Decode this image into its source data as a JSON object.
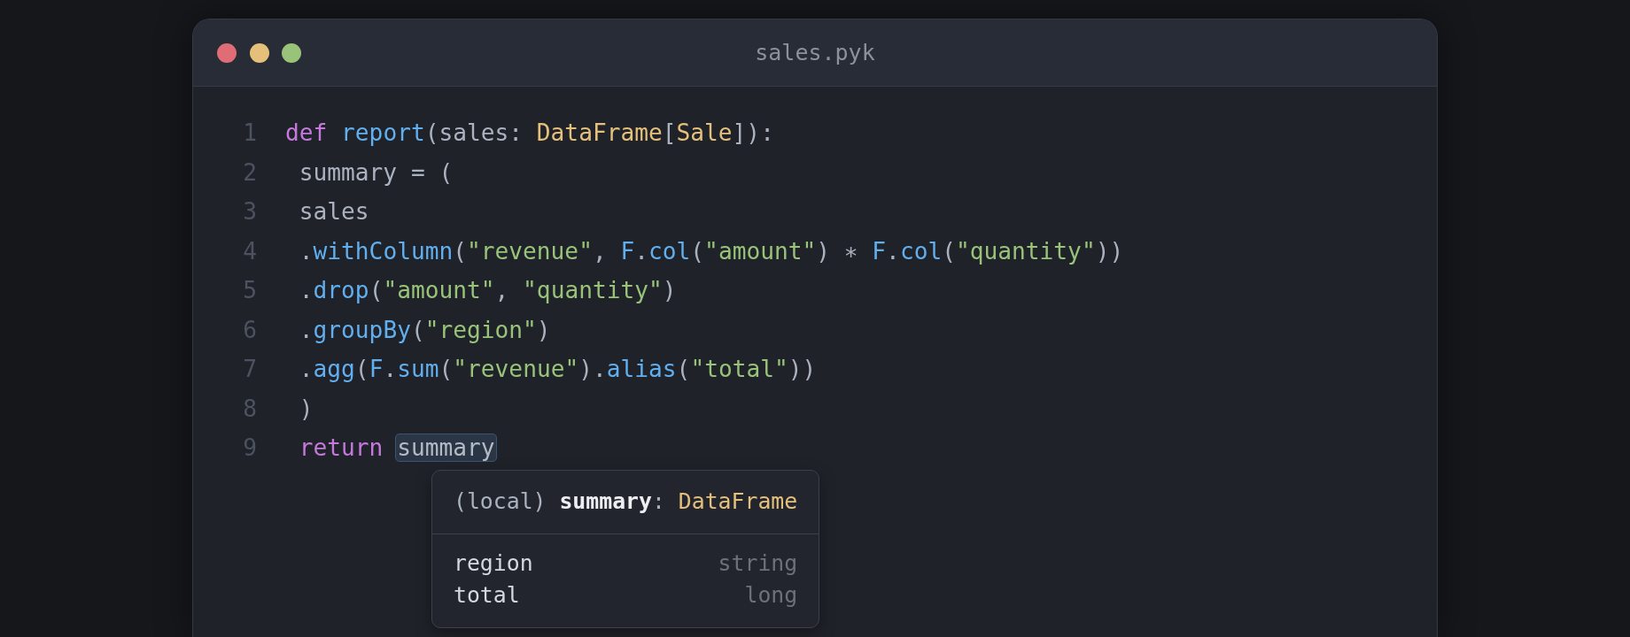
{
  "window": {
    "title": "sales.pyk",
    "buttons": [
      {
        "kind": "close"
      },
      {
        "kind": "minimize"
      },
      {
        "kind": "maximize"
      }
    ]
  },
  "editor": {
    "lines": [
      {
        "number": "1",
        "tokens": [
          {
            "kind": "keyword",
            "text": "def "
          },
          {
            "kind": "function",
            "text": "report"
          },
          {
            "kind": "plain",
            "text": "(sales: "
          },
          {
            "kind": "type",
            "text": "DataFrame"
          },
          {
            "kind": "plain",
            "text": "["
          },
          {
            "kind": "type",
            "text": "Sale"
          },
          {
            "kind": "plain",
            "text": "]):"
          }
        ],
        "children": [
          {
            "number": "2",
            "tokens": [
              {
                "kind": "plain",
                "text": "summary = ("
              }
            ]
          },
          {
            "number": "3",
            "tokens": [
              {
                "kind": "plain",
                "text": "sales"
              }
            ]
          },
          {
            "number": "4",
            "tokens": [
              {
                "kind": "plain",
                "text": "."
              },
              {
                "kind": "function",
                "text": "withColumn"
              },
              {
                "kind": "plain",
                "text": "("
              },
              {
                "kind": "string",
                "text": "\"revenue\""
              },
              {
                "kind": "plain",
                "text": ", "
              },
              {
                "kind": "function",
                "text": "F"
              },
              {
                "kind": "plain",
                "text": "."
              },
              {
                "kind": "function",
                "text": "col"
              },
              {
                "kind": "plain",
                "text": "("
              },
              {
                "kind": "string",
                "text": "\"amount\""
              },
              {
                "kind": "plain",
                "text": ") ∗ "
              },
              {
                "kind": "function",
                "text": "F"
              },
              {
                "kind": "plain",
                "text": "."
              },
              {
                "kind": "function",
                "text": "col"
              },
              {
                "kind": "plain",
                "text": "("
              },
              {
                "kind": "string",
                "text": "\"quantity\""
              },
              {
                "kind": "plain",
                "text": "))"
              }
            ]
          },
          {
            "number": "5",
            "tokens": [
              {
                "kind": "plain",
                "text": "."
              },
              {
                "kind": "function",
                "text": "drop"
              },
              {
                "kind": "plain",
                "text": "("
              },
              {
                "kind": "string",
                "text": "\"amount\""
              },
              {
                "kind": "plain",
                "text": ", "
              },
              {
                "kind": "string",
                "text": "\"quantity\""
              },
              {
                "kind": "plain",
                "text": ")"
              }
            ]
          },
          {
            "number": "6",
            "tokens": [
              {
                "kind": "plain",
                "text": "."
              },
              {
                "kind": "function",
                "text": "groupBy"
              },
              {
                "kind": "plain",
                "text": "("
              },
              {
                "kind": "string",
                "text": "\"region\""
              },
              {
                "kind": "plain",
                "text": ")"
              }
            ]
          },
          {
            "number": "7",
            "tokens": [
              {
                "kind": "plain",
                "text": "."
              },
              {
                "kind": "function",
                "text": "agg"
              },
              {
                "kind": "plain",
                "text": "("
              },
              {
                "kind": "function",
                "text": "F"
              },
              {
                "kind": "plain",
                "text": "."
              },
              {
                "kind": "function",
                "text": "sum"
              },
              {
                "kind": "plain",
                "text": "("
              },
              {
                "kind": "string",
                "text": "\"revenue\""
              },
              {
                "kind": "plain",
                "text": ")."
              },
              {
                "kind": "function",
                "text": "alias"
              },
              {
                "kind": "plain",
                "text": "("
              },
              {
                "kind": "string",
                "text": "\"total\""
              },
              {
                "kind": "plain",
                "text": "))"
              }
            ]
          },
          {
            "number": "8",
            "tokens": [
              {
                "kind": "plain",
                "text": ")"
              }
            ]
          },
          {
            "number": "9",
            "tokens": [
              {
                "kind": "keyword",
                "text": "return "
              },
              {
                "kind": "highlight",
                "text": "summary"
              }
            ]
          }
        ]
      }
    ]
  },
  "tooltip": {
    "signature": [
      {
        "kind": "plain",
        "text": "(local) "
      },
      {
        "kind": "name",
        "text": "summary"
      },
      {
        "kind": "plain",
        "text": ": "
      },
      {
        "kind": "type",
        "text": "DataFrame"
      }
    ],
    "fields": [
      {
        "name": "region",
        "type": "string"
      },
      {
        "name": "total",
        "type": "long"
      }
    ]
  }
}
